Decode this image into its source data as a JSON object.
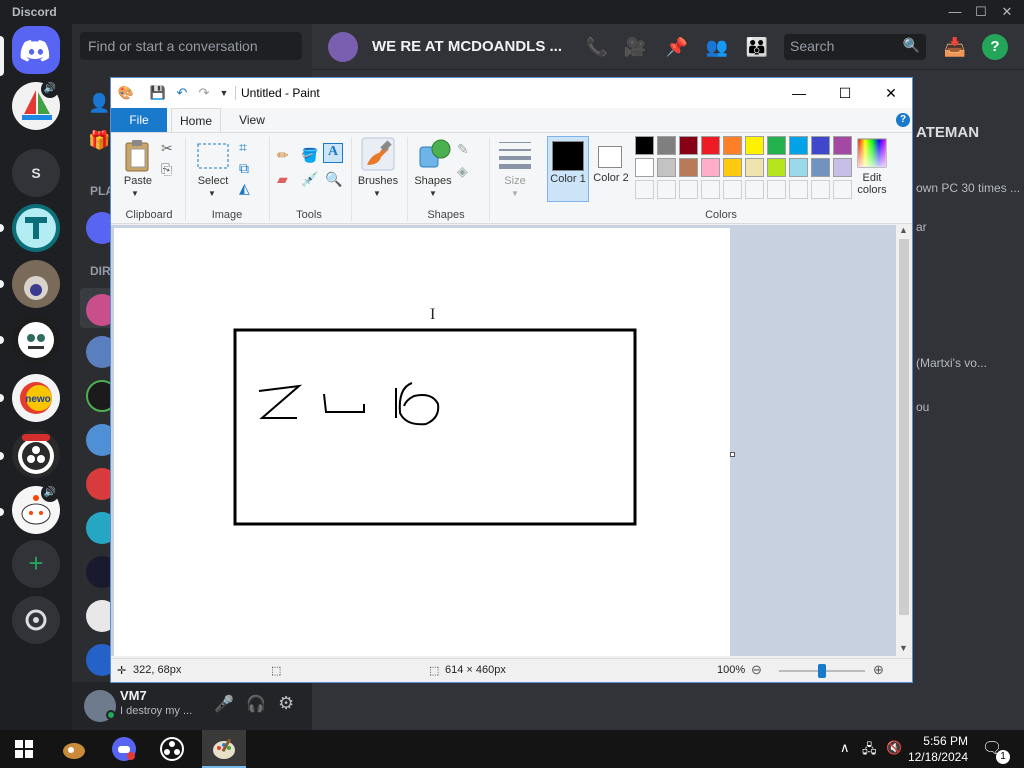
{
  "discord": {
    "app_name": "Discord",
    "search_conversation_placeholder": "Find or start a conversation",
    "channel_header_title": "WE RE AT MCDOANDLS ...",
    "search_placeholder": "Search",
    "user": {
      "name": "VM7",
      "status": "I destroy my ..."
    },
    "sidebar_partial_labels": {
      "friends_section": "PLA",
      "direct_messages": "DIR"
    },
    "side_panel_partial": {
      "line1": "ATEMAN",
      "line2": "own PC 30 times ...",
      "line3": "(Martxi's vo...",
      "line4": "ar",
      "line5": "ou"
    }
  },
  "paint": {
    "title": "Untitled - Paint",
    "tabs": [
      "File",
      "Home",
      "View"
    ],
    "groups": {
      "clipboard": "Clipboard",
      "image": "Image",
      "tools": "Tools",
      "shapes": "Shapes",
      "colors": "Colors"
    },
    "buttons": {
      "paste": "Paste",
      "select": "Select",
      "brushes": "Brushes",
      "shapes": "Shapes",
      "size": "Size",
      "color1": "Color 1",
      "color2": "Color 2",
      "edit_colors": "Edit colors"
    },
    "palette_row1": [
      "#000000",
      "#7f7f7f",
      "#880015",
      "#ed1c24",
      "#ff7f27",
      "#fff200",
      "#22b14c",
      "#00a2e8",
      "#3f48cc",
      "#a349a4"
    ],
    "palette_row2": [
      "#ffffff",
      "#c3c3c3",
      "#b97a57",
      "#ffaec9",
      "#ffc90e",
      "#efe4b0",
      "#b5e61d",
      "#99d9ea",
      "#7092be",
      "#c8bfe7"
    ],
    "color1_value": "#000000",
    "color2_value": "#ffffff",
    "status": {
      "cursor_position": "322, 68px",
      "canvas_size": "614 × 460px",
      "zoom": "100%"
    },
    "zoom_level_fraction": 0.5
  },
  "taskbar": {
    "time": "5:56 PM",
    "date": "12/18/2024",
    "notifications": "1"
  }
}
